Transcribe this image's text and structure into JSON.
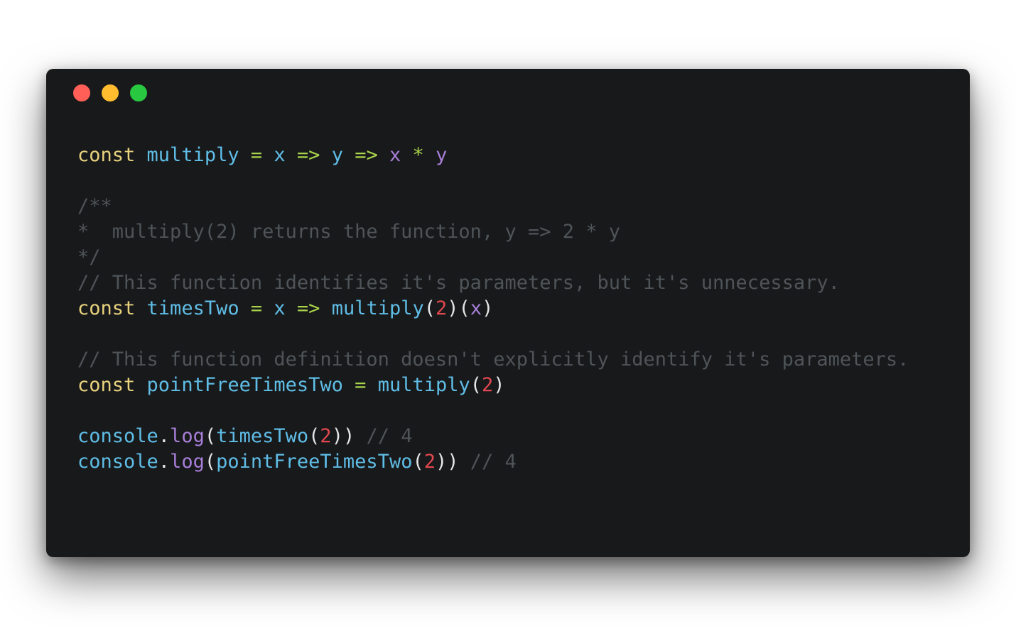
{
  "window": {
    "traffic_lights": [
      {
        "name": "close-dot",
        "color": "#ff5f57"
      },
      {
        "name": "minimize-dot",
        "color": "#febc2e"
      },
      {
        "name": "maximize-dot",
        "color": "#28c840"
      }
    ]
  },
  "syntax_colors": {
    "keyword": "#e8d27d",
    "identifier": "#5fbde6",
    "operator": "#a8d34a",
    "param": "#a77fd8",
    "comment": "#4e5458",
    "number": "#e2474f",
    "punct": "#e6e6e6"
  },
  "code": {
    "lines": [
      [
        {
          "t": "const",
          "c": "keyword"
        },
        {
          "t": " ",
          "c": "punct"
        },
        {
          "t": "multiply",
          "c": "identifier"
        },
        {
          "t": " ",
          "c": "punct"
        },
        {
          "t": "=",
          "c": "operator"
        },
        {
          "t": " ",
          "c": "punct"
        },
        {
          "t": "x",
          "c": "identifier"
        },
        {
          "t": " ",
          "c": "punct"
        },
        {
          "t": "=>",
          "c": "operator"
        },
        {
          "t": " ",
          "c": "punct"
        },
        {
          "t": "y",
          "c": "identifier"
        },
        {
          "t": " ",
          "c": "punct"
        },
        {
          "t": "=>",
          "c": "operator"
        },
        {
          "t": " ",
          "c": "punct"
        },
        {
          "t": "x",
          "c": "param"
        },
        {
          "t": " ",
          "c": "punct"
        },
        {
          "t": "*",
          "c": "operator"
        },
        {
          "t": " ",
          "c": "punct"
        },
        {
          "t": "y",
          "c": "param"
        }
      ],
      [],
      [
        {
          "t": "/**",
          "c": "comment"
        }
      ],
      [
        {
          "t": "*  multiply(2) returns the function, y => 2 * y",
          "c": "comment"
        }
      ],
      [
        {
          "t": "*/",
          "c": "comment"
        }
      ],
      [
        {
          "t": "// This function identifies it's parameters, but it's unnecessary.",
          "c": "comment"
        }
      ],
      [
        {
          "t": "const",
          "c": "keyword"
        },
        {
          "t": " ",
          "c": "punct"
        },
        {
          "t": "timesTwo",
          "c": "identifier"
        },
        {
          "t": " ",
          "c": "punct"
        },
        {
          "t": "=",
          "c": "operator"
        },
        {
          "t": " ",
          "c": "punct"
        },
        {
          "t": "x",
          "c": "identifier"
        },
        {
          "t": " ",
          "c": "punct"
        },
        {
          "t": "=>",
          "c": "operator"
        },
        {
          "t": " ",
          "c": "punct"
        },
        {
          "t": "multiply",
          "c": "identifier"
        },
        {
          "t": "(",
          "c": "punct"
        },
        {
          "t": "2",
          "c": "number"
        },
        {
          "t": ")",
          "c": "punct"
        },
        {
          "t": "(",
          "c": "punct"
        },
        {
          "t": "x",
          "c": "param"
        },
        {
          "t": ")",
          "c": "punct"
        }
      ],
      [],
      [
        {
          "t": "// This function definition doesn't explicitly identify it's parameters.",
          "c": "comment"
        }
      ],
      [
        {
          "t": "const",
          "c": "keyword"
        },
        {
          "t": " ",
          "c": "punct"
        },
        {
          "t": "pointFreeTimesTwo",
          "c": "identifier"
        },
        {
          "t": " ",
          "c": "punct"
        },
        {
          "t": "=",
          "c": "operator"
        },
        {
          "t": " ",
          "c": "punct"
        },
        {
          "t": "multiply",
          "c": "identifier"
        },
        {
          "t": "(",
          "c": "punct"
        },
        {
          "t": "2",
          "c": "number"
        },
        {
          "t": ")",
          "c": "punct"
        }
      ],
      [],
      [
        {
          "t": "console",
          "c": "identifier"
        },
        {
          "t": ".",
          "c": "punct"
        },
        {
          "t": "log",
          "c": "param"
        },
        {
          "t": "(",
          "c": "punct"
        },
        {
          "t": "timesTwo",
          "c": "identifier"
        },
        {
          "t": "(",
          "c": "punct"
        },
        {
          "t": "2",
          "c": "number"
        },
        {
          "t": "))",
          "c": "punct"
        },
        {
          "t": " ",
          "c": "punct"
        },
        {
          "t": "// 4",
          "c": "comment"
        }
      ],
      [
        {
          "t": "console",
          "c": "identifier"
        },
        {
          "t": ".",
          "c": "punct"
        },
        {
          "t": "log",
          "c": "param"
        },
        {
          "t": "(",
          "c": "punct"
        },
        {
          "t": "pointFreeTimesTwo",
          "c": "identifier"
        },
        {
          "t": "(",
          "c": "punct"
        },
        {
          "t": "2",
          "c": "number"
        },
        {
          "t": "))",
          "c": "punct"
        },
        {
          "t": " ",
          "c": "punct"
        },
        {
          "t": "// 4",
          "c": "comment"
        }
      ]
    ]
  }
}
